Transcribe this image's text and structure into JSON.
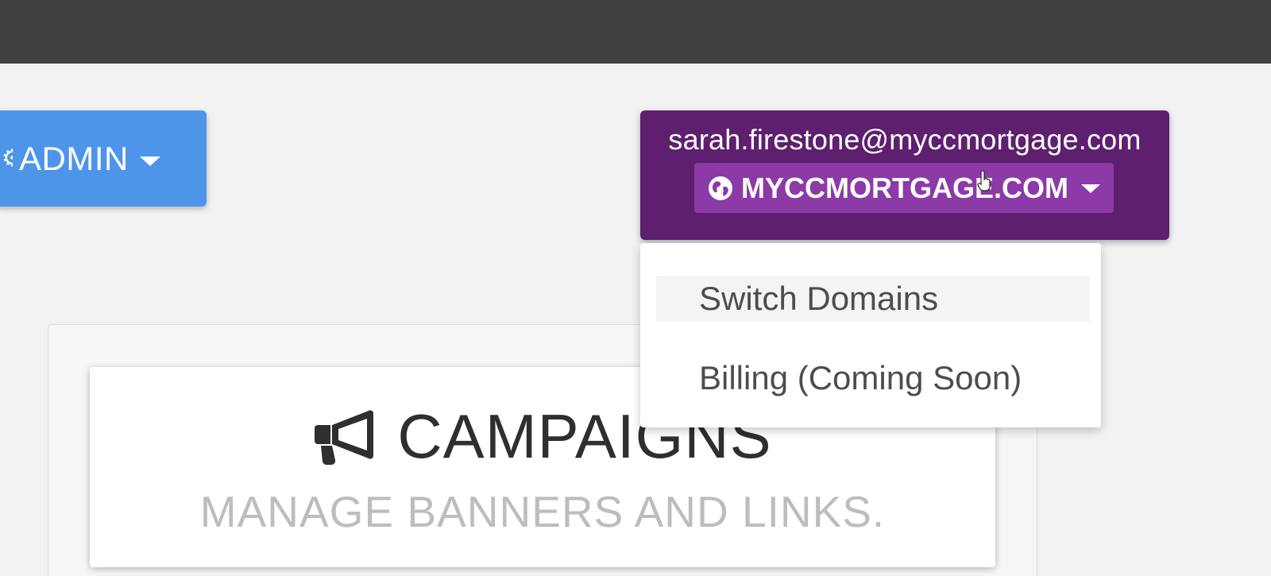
{
  "admin_menu": {
    "label": "ADMIN"
  },
  "account": {
    "email": "sarah.firestone@myccmortgage.com",
    "domain_label": "MYCCMORTGAGE.COM",
    "colors": {
      "header": "#5d1f6e",
      "button": "#8c3aa8"
    }
  },
  "account_dropdown": {
    "items": [
      {
        "label": "Switch Domains"
      },
      {
        "label": "Billing (Coming Soon)"
      }
    ]
  },
  "campaigns_card": {
    "icon": "megaphone-icon",
    "title": "CAMPAIGNS",
    "subtitle": "MANAGE BANNERS AND LINKS."
  },
  "colors": {
    "topbar": "#404042",
    "admin_button": "#4d95e9",
    "background": "#f2f2f3"
  }
}
